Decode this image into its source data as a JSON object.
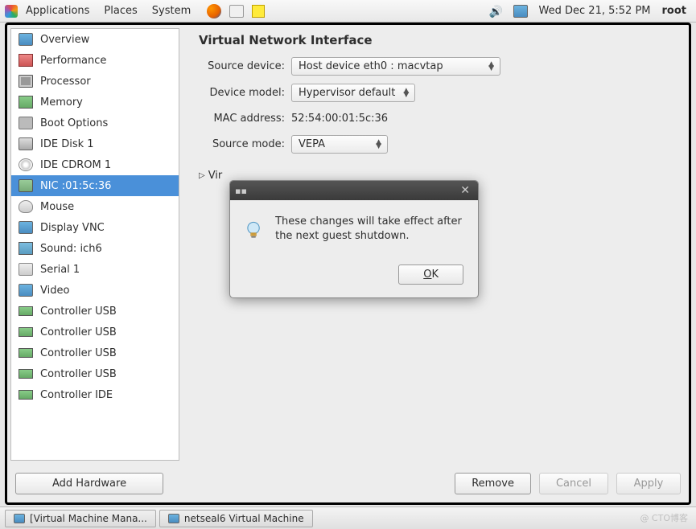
{
  "panel": {
    "apps": "Applications",
    "places": "Places",
    "system": "System",
    "clock": "Wed Dec 21,  5:52 PM",
    "user": "root"
  },
  "sidebar": {
    "items": [
      {
        "label": "Overview"
      },
      {
        "label": "Performance"
      },
      {
        "label": "Processor"
      },
      {
        "label": "Memory"
      },
      {
        "label": "Boot Options"
      },
      {
        "label": "IDE Disk 1"
      },
      {
        "label": "IDE CDROM 1"
      },
      {
        "label": "NIC :01:5c:36"
      },
      {
        "label": "Mouse"
      },
      {
        "label": "Display VNC"
      },
      {
        "label": "Sound: ich6"
      },
      {
        "label": "Serial 1"
      },
      {
        "label": "Video"
      },
      {
        "label": "Controller USB"
      },
      {
        "label": "Controller USB"
      },
      {
        "label": "Controller USB"
      },
      {
        "label": "Controller USB"
      },
      {
        "label": "Controller IDE"
      }
    ]
  },
  "content": {
    "title": "Virtual Network Interface",
    "source_device_label": "Source device:",
    "source_device_value": "Host device eth0 : macvtap",
    "device_model_label": "Device model:",
    "device_model_value": "Hypervisor default",
    "mac_label": "MAC address:",
    "mac_value": "52:54:00:01:5c:36",
    "source_mode_label": "Source mode:",
    "source_mode_value": "VEPA",
    "expander_label": "Vir"
  },
  "dialog": {
    "message": "These changes will take effect after the next guest shutdown.",
    "ok": "OK"
  },
  "buttons": {
    "add": "Add Hardware",
    "remove": "Remove",
    "cancel": "Cancel",
    "apply": "Apply"
  },
  "taskbar": {
    "task1": "[Virtual Machine Mana...",
    "task2": "netseal6 Virtual Machine"
  }
}
